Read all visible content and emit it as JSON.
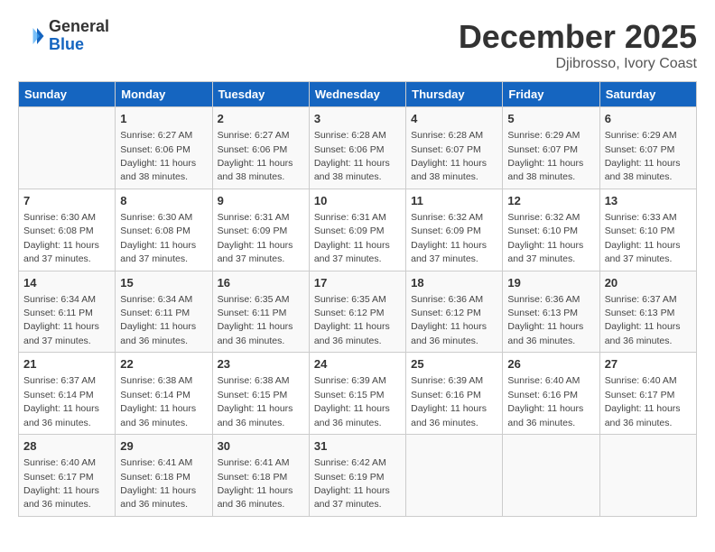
{
  "header": {
    "logo_general": "General",
    "logo_blue": "Blue",
    "month_year": "December 2025",
    "location": "Djibrosso, Ivory Coast"
  },
  "calendar": {
    "days_of_week": [
      "Sunday",
      "Monday",
      "Tuesday",
      "Wednesday",
      "Thursday",
      "Friday",
      "Saturday"
    ],
    "weeks": [
      [
        {
          "day": "",
          "info": ""
        },
        {
          "day": "1",
          "info": "Sunrise: 6:27 AM\nSunset: 6:06 PM\nDaylight: 11 hours\nand 38 minutes."
        },
        {
          "day": "2",
          "info": "Sunrise: 6:27 AM\nSunset: 6:06 PM\nDaylight: 11 hours\nand 38 minutes."
        },
        {
          "day": "3",
          "info": "Sunrise: 6:28 AM\nSunset: 6:06 PM\nDaylight: 11 hours\nand 38 minutes."
        },
        {
          "day": "4",
          "info": "Sunrise: 6:28 AM\nSunset: 6:07 PM\nDaylight: 11 hours\nand 38 minutes."
        },
        {
          "day": "5",
          "info": "Sunrise: 6:29 AM\nSunset: 6:07 PM\nDaylight: 11 hours\nand 38 minutes."
        },
        {
          "day": "6",
          "info": "Sunrise: 6:29 AM\nSunset: 6:07 PM\nDaylight: 11 hours\nand 38 minutes."
        }
      ],
      [
        {
          "day": "7",
          "info": "Sunrise: 6:30 AM\nSunset: 6:08 PM\nDaylight: 11 hours\nand 37 minutes."
        },
        {
          "day": "8",
          "info": "Sunrise: 6:30 AM\nSunset: 6:08 PM\nDaylight: 11 hours\nand 37 minutes."
        },
        {
          "day": "9",
          "info": "Sunrise: 6:31 AM\nSunset: 6:09 PM\nDaylight: 11 hours\nand 37 minutes."
        },
        {
          "day": "10",
          "info": "Sunrise: 6:31 AM\nSunset: 6:09 PM\nDaylight: 11 hours\nand 37 minutes."
        },
        {
          "day": "11",
          "info": "Sunrise: 6:32 AM\nSunset: 6:09 PM\nDaylight: 11 hours\nand 37 minutes."
        },
        {
          "day": "12",
          "info": "Sunrise: 6:32 AM\nSunset: 6:10 PM\nDaylight: 11 hours\nand 37 minutes."
        },
        {
          "day": "13",
          "info": "Sunrise: 6:33 AM\nSunset: 6:10 PM\nDaylight: 11 hours\nand 37 minutes."
        }
      ],
      [
        {
          "day": "14",
          "info": "Sunrise: 6:34 AM\nSunset: 6:11 PM\nDaylight: 11 hours\nand 37 minutes."
        },
        {
          "day": "15",
          "info": "Sunrise: 6:34 AM\nSunset: 6:11 PM\nDaylight: 11 hours\nand 36 minutes."
        },
        {
          "day": "16",
          "info": "Sunrise: 6:35 AM\nSunset: 6:11 PM\nDaylight: 11 hours\nand 36 minutes."
        },
        {
          "day": "17",
          "info": "Sunrise: 6:35 AM\nSunset: 6:12 PM\nDaylight: 11 hours\nand 36 minutes."
        },
        {
          "day": "18",
          "info": "Sunrise: 6:36 AM\nSunset: 6:12 PM\nDaylight: 11 hours\nand 36 minutes."
        },
        {
          "day": "19",
          "info": "Sunrise: 6:36 AM\nSunset: 6:13 PM\nDaylight: 11 hours\nand 36 minutes."
        },
        {
          "day": "20",
          "info": "Sunrise: 6:37 AM\nSunset: 6:13 PM\nDaylight: 11 hours\nand 36 minutes."
        }
      ],
      [
        {
          "day": "21",
          "info": "Sunrise: 6:37 AM\nSunset: 6:14 PM\nDaylight: 11 hours\nand 36 minutes."
        },
        {
          "day": "22",
          "info": "Sunrise: 6:38 AM\nSunset: 6:14 PM\nDaylight: 11 hours\nand 36 minutes."
        },
        {
          "day": "23",
          "info": "Sunrise: 6:38 AM\nSunset: 6:15 PM\nDaylight: 11 hours\nand 36 minutes."
        },
        {
          "day": "24",
          "info": "Sunrise: 6:39 AM\nSunset: 6:15 PM\nDaylight: 11 hours\nand 36 minutes."
        },
        {
          "day": "25",
          "info": "Sunrise: 6:39 AM\nSunset: 6:16 PM\nDaylight: 11 hours\nand 36 minutes."
        },
        {
          "day": "26",
          "info": "Sunrise: 6:40 AM\nSunset: 6:16 PM\nDaylight: 11 hours\nand 36 minutes."
        },
        {
          "day": "27",
          "info": "Sunrise: 6:40 AM\nSunset: 6:17 PM\nDaylight: 11 hours\nand 36 minutes."
        }
      ],
      [
        {
          "day": "28",
          "info": "Sunrise: 6:40 AM\nSunset: 6:17 PM\nDaylight: 11 hours\nand 36 minutes."
        },
        {
          "day": "29",
          "info": "Sunrise: 6:41 AM\nSunset: 6:18 PM\nDaylight: 11 hours\nand 36 minutes."
        },
        {
          "day": "30",
          "info": "Sunrise: 6:41 AM\nSunset: 6:18 PM\nDaylight: 11 hours\nand 36 minutes."
        },
        {
          "day": "31",
          "info": "Sunrise: 6:42 AM\nSunset: 6:19 PM\nDaylight: 11 hours\nand 37 minutes."
        },
        {
          "day": "",
          "info": ""
        },
        {
          "day": "",
          "info": ""
        },
        {
          "day": "",
          "info": ""
        }
      ]
    ]
  }
}
